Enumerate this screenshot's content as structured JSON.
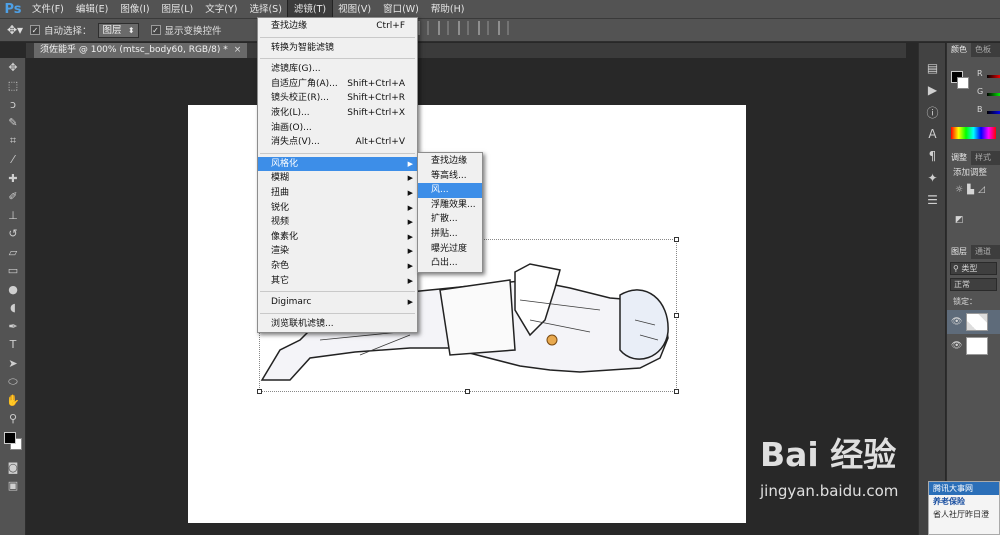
{
  "app": {
    "logo": "Ps"
  },
  "menubar": [
    "文件(F)",
    "编辑(E)",
    "图像(I)",
    "图层(L)",
    "文字(Y)",
    "选择(S)",
    "滤镜(T)",
    "视图(V)",
    "窗口(W)",
    "帮助(H)"
  ],
  "options": {
    "auto_select_label": "自动选择：",
    "auto_select_value": "图层",
    "show_transform_label": "显示变换控件"
  },
  "document": {
    "tab_title": "须佐能乎 @ 100% (mtsc_body60, RGB/8) *",
    "close": "×"
  },
  "filter_menu": {
    "items": [
      {
        "label": "查找边缘",
        "shortcut": "Ctrl+F"
      },
      {
        "sep": true
      },
      {
        "label": "转换为智能滤镜"
      },
      {
        "sep": true
      },
      {
        "label": "滤镜库(G)..."
      },
      {
        "label": "自适应广角(A)...",
        "shortcut": "Shift+Ctrl+A"
      },
      {
        "label": "镜头校正(R)...",
        "shortcut": "Shift+Ctrl+R"
      },
      {
        "label": "液化(L)...",
        "shortcut": "Shift+Ctrl+X"
      },
      {
        "label": "油画(O)..."
      },
      {
        "label": "消失点(V)...",
        "shortcut": "Alt+Ctrl+V"
      },
      {
        "sep": true
      },
      {
        "label": "风格化",
        "submenu": true,
        "highlight": true
      },
      {
        "label": "模糊",
        "submenu": true
      },
      {
        "label": "扭曲",
        "submenu": true
      },
      {
        "label": "锐化",
        "submenu": true
      },
      {
        "label": "视频",
        "submenu": true
      },
      {
        "label": "像素化",
        "submenu": true
      },
      {
        "label": "渲染",
        "submenu": true
      },
      {
        "label": "杂色",
        "submenu": true
      },
      {
        "label": "其它",
        "submenu": true
      },
      {
        "sep": true
      },
      {
        "label": "Digimarc",
        "submenu": true
      },
      {
        "sep": true
      },
      {
        "label": "浏览联机滤镜..."
      }
    ]
  },
  "stylize_submenu": [
    "查找边缘",
    "等高线...",
    "风...",
    "浮雕效果...",
    "扩散...",
    "拼贴...",
    "曝光过度",
    "凸出..."
  ],
  "stylize_highlight": "风...",
  "panels": {
    "color_tabs": [
      "颜色",
      "色板"
    ],
    "color_channels": [
      "R",
      "G",
      "B"
    ],
    "adjust_tabs": [
      "调整",
      "样式"
    ],
    "adjust_title": "添加调整",
    "layers_tabs": [
      "图层",
      "通道"
    ],
    "layers_filter": "类型",
    "blend_mode": "正常",
    "lock_label": "锁定："
  },
  "watermark": {
    "logo": "Bai 经验",
    "url": "jingyan.baidu.com"
  },
  "notification": {
    "lines": [
      "腾讯大事网",
      "养老保险",
      "省人社厅昨日澄"
    ]
  }
}
